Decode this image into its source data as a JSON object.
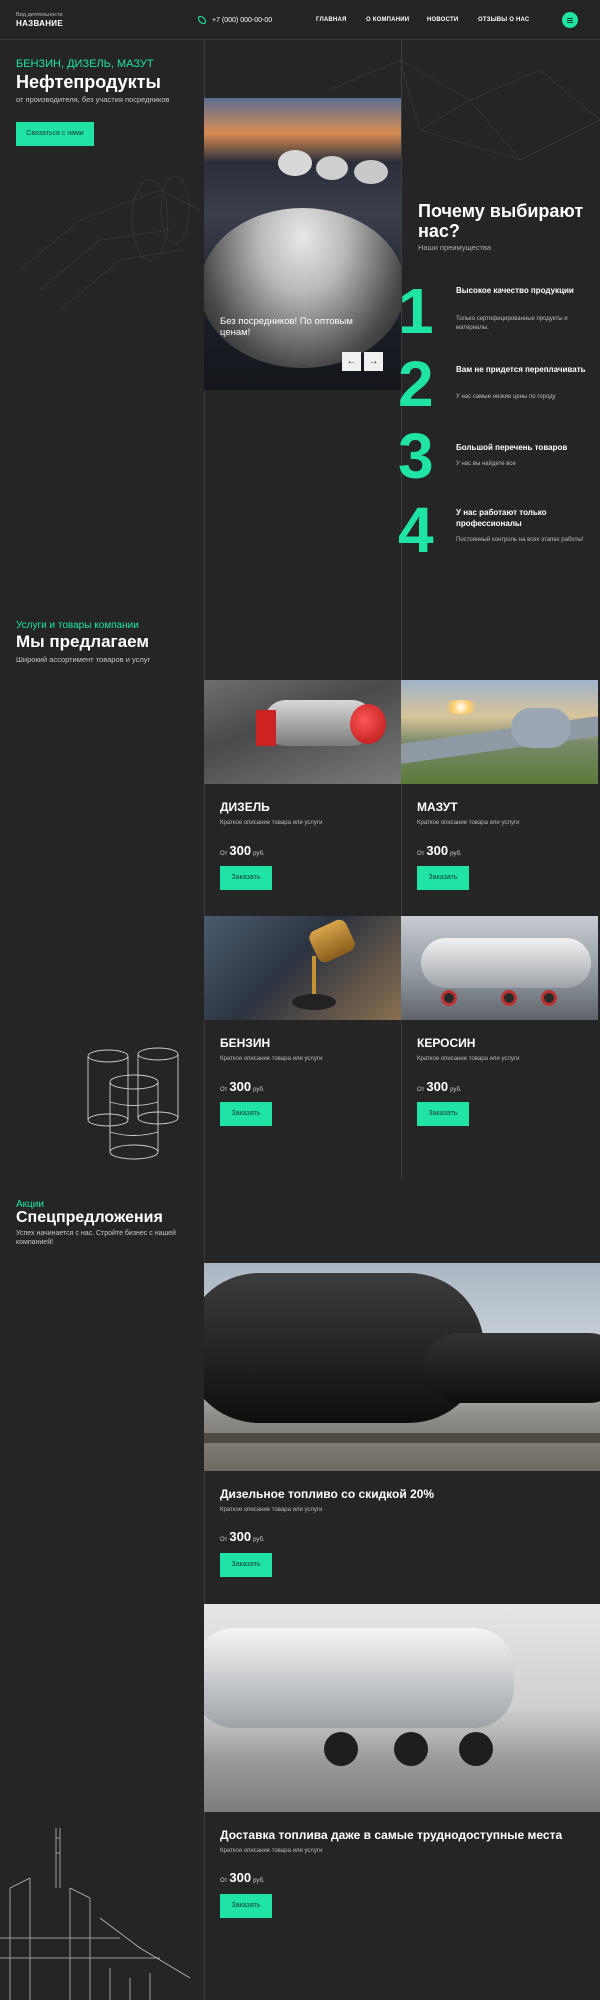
{
  "header": {
    "logo_sub": "Вид деятельности",
    "logo_main": "НАЗВАНИЕ",
    "phone": "+7 (000) 000-00-00",
    "nav": [
      "ГЛАВНАЯ",
      "О КОМПАНИИ",
      "НОВОСТИ",
      "ОТЗЫВЫ О НАС"
    ],
    "menu_icon": "hamburger-icon"
  },
  "hero": {
    "subtitle": "БЕНЗИН, ДИЗЕЛЬ, МАЗУТ",
    "title": "Нефтепродукты",
    "description": "от производителя, без участия посредников",
    "button": "Связаться с нами"
  },
  "slider": {
    "caption": "Без посредников! По оптовым ценам!",
    "prev": "←",
    "next": "→"
  },
  "why": {
    "title": "Почему выбирают нас?",
    "subtitle": "Наши преимущества",
    "items": [
      {
        "num": "1",
        "title": "Высокое качество продукции",
        "text": "Только сертифицированные продукты и материалы."
      },
      {
        "num": "2",
        "title": "Вам не придется переплачивать",
        "text": "У нас самые низкие цены по городу"
      },
      {
        "num": "3",
        "title": "Большой перечень товаров",
        "text": "У нас вы найдете все"
      },
      {
        "num": "4",
        "title": "У нас работают только профессионалы",
        "text": "Постоянный контроль на всех этапах работы!"
      }
    ]
  },
  "offers": {
    "subtitle": "Услуги и товары компании",
    "title": "Мы предлагаем",
    "description": "Широкий ассортимент товаров и услуг",
    "cards": [
      {
        "name": "ДИЗЕЛЬ",
        "desc": "Краткое описание товара или услуги",
        "from": "От",
        "price": "300",
        "unit": "руб.",
        "button": "Заказать"
      },
      {
        "name": "МАЗУТ",
        "desc": "Краткое описание товара или услуги",
        "from": "От",
        "price": "300",
        "unit": "руб.",
        "button": "Заказать"
      },
      {
        "name": "БЕНЗИН",
        "desc": "Краткое описание товара или услуги",
        "from": "От",
        "price": "300",
        "unit": "руб.",
        "button": "Заказать"
      },
      {
        "name": "КЕРОСИН",
        "desc": "Краткое описание товара или услуги",
        "from": "От",
        "price": "300",
        "unit": "руб.",
        "button": "Заказать"
      }
    ]
  },
  "specials": {
    "subtitle": "Акции",
    "title": "Спецпредложения",
    "description": "Успех начинается с нас. Стройте бизнес с нашей компанией!",
    "items": [
      {
        "name": "Дизельное топливо со скидкой 20%",
        "desc": "Краткое описание товара или услуги",
        "from": "От",
        "price": "300",
        "unit": "руб.",
        "button": "Заказать"
      },
      {
        "name": "Доставка топлива даже в самые труднодоступные места",
        "desc": "Краткое описание товара или услуги",
        "from": "От",
        "price": "300",
        "unit": "руб.",
        "button": "Заказать"
      }
    ]
  },
  "colors": {
    "accent": "#1fe4a6",
    "background": "#252525"
  }
}
